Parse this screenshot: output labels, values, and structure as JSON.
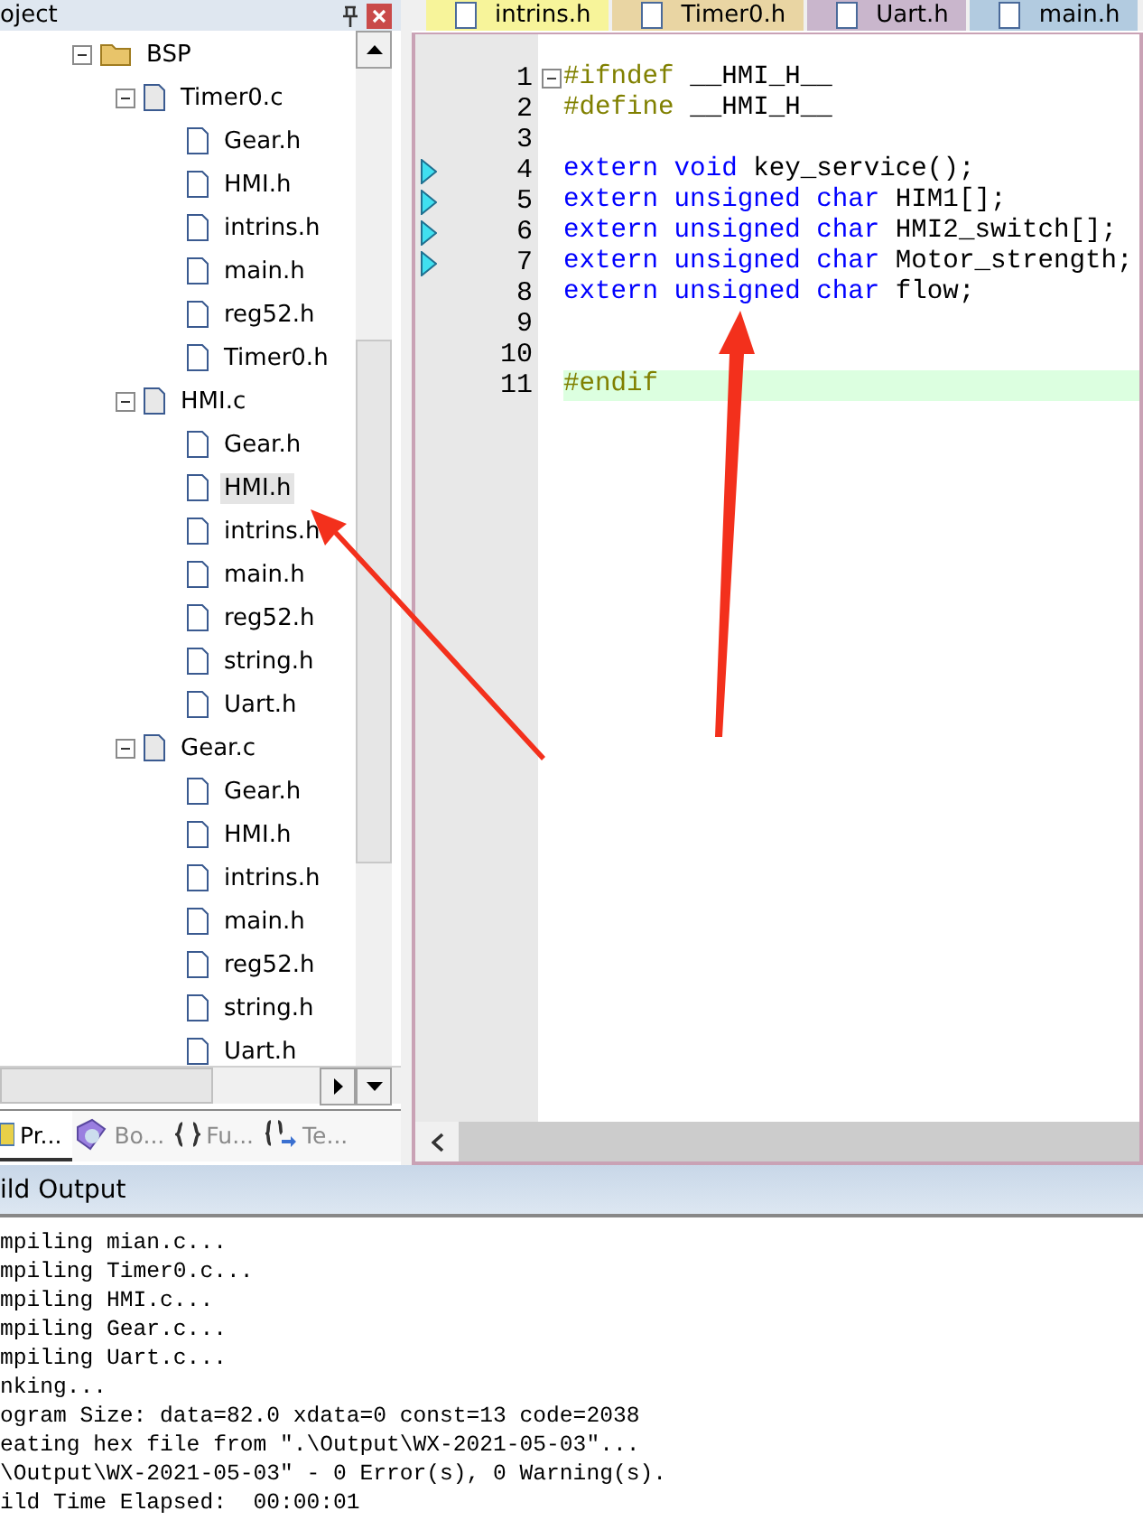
{
  "project_panel": {
    "title": "oject",
    "tree": [
      {
        "label": "BSP",
        "expanded": true,
        "selected": false,
        "children": [
          {
            "label": "Timer0.c",
            "expanded": true,
            "selected": false,
            "children": [
              {
                "label": "Gear.h",
                "selected": false
              },
              {
                "label": "HMI.h",
                "selected": false
              },
              {
                "label": "intrins.h",
                "selected": false
              },
              {
                "label": "main.h",
                "selected": false
              },
              {
                "label": "reg52.h",
                "selected": false
              },
              {
                "label": "Timer0.h",
                "selected": false
              }
            ]
          },
          {
            "label": "HMI.c",
            "expanded": true,
            "selected": false,
            "children": [
              {
                "label": "Gear.h",
                "selected": false
              },
              {
                "label": "HMI.h",
                "selected": true
              },
              {
                "label": "intrins.h",
                "selected": false
              },
              {
                "label": "main.h",
                "selected": false
              },
              {
                "label": "reg52.h",
                "selected": false
              },
              {
                "label": "string.h",
                "selected": false
              },
              {
                "label": "Uart.h",
                "selected": false
              }
            ]
          },
          {
            "label": "Gear.c",
            "expanded": true,
            "selected": false,
            "children": [
              {
                "label": "Gear.h",
                "selected": false
              },
              {
                "label": "HMI.h",
                "selected": false
              },
              {
                "label": "intrins.h",
                "selected": false
              },
              {
                "label": "main.h",
                "selected": false
              },
              {
                "label": "reg52.h",
                "selected": false
              },
              {
                "label": "string.h",
                "selected": false
              },
              {
                "label": "Uart.h",
                "selected": false
              }
            ]
          }
        ]
      }
    ],
    "tabs": [
      {
        "label": "Pr...",
        "kind": "project",
        "selected": true
      },
      {
        "label": "Bo...",
        "kind": "books",
        "selected": false
      },
      {
        "label": "Fu...",
        "kind": "functions",
        "selected": false
      },
      {
        "label": "Te...",
        "kind": "templates",
        "selected": false
      }
    ]
  },
  "editor": {
    "tabs": [
      {
        "label": "intrins.h",
        "color": "#f7f49a"
      },
      {
        "label": "Timer0.h",
        "color": "#e9d5a3"
      },
      {
        "label": "Uart.h",
        "color": "#c9b6cc"
      },
      {
        "label": "main.h",
        "color": "#b2cbe0"
      }
    ],
    "lines": [
      {
        "number": "1",
        "marker": false,
        "current": false,
        "tokens": [
          {
            "kind": "pre",
            "text": "#ifndef"
          },
          {
            "kind": "plain",
            "text": " __HMI_H__"
          }
        ]
      },
      {
        "number": "2",
        "marker": false,
        "current": false,
        "tokens": [
          {
            "kind": "pre",
            "text": "#define"
          },
          {
            "kind": "plain",
            "text": " __HMI_H__"
          }
        ]
      },
      {
        "number": "3",
        "marker": false,
        "current": false
      },
      {
        "number": "4",
        "marker": true,
        "current": false,
        "tokens": [
          {
            "kind": "keyword",
            "text": "extern void"
          },
          {
            "kind": "plain",
            "text": " key_service();"
          }
        ]
      },
      {
        "number": "5",
        "marker": true,
        "current": false,
        "tokens": [
          {
            "kind": "keyword",
            "text": "extern unsigned char"
          },
          {
            "kind": "plain",
            "text": " HIM1[];"
          }
        ]
      },
      {
        "number": "6",
        "marker": true,
        "current": false,
        "tokens": [
          {
            "kind": "keyword",
            "text": "extern unsigned char"
          },
          {
            "kind": "plain",
            "text": " HMI2_switch[];"
          }
        ]
      },
      {
        "number": "7",
        "marker": true,
        "current": false,
        "tokens": [
          {
            "kind": "keyword",
            "text": "extern unsigned char"
          },
          {
            "kind": "plain",
            "text": " Motor_strength;"
          }
        ]
      },
      {
        "number": "8",
        "marker": false,
        "current": false,
        "tokens": [
          {
            "kind": "keyword",
            "text": "extern unsigned char"
          },
          {
            "kind": "plain",
            "text": " flow;"
          }
        ]
      },
      {
        "number": "9",
        "marker": false,
        "current": false
      },
      {
        "number": "10",
        "marker": false,
        "current": false
      },
      {
        "number": "11",
        "marker": false,
        "current": true,
        "tokens": [
          {
            "kind": "pre",
            "text": "#endif"
          }
        ]
      }
    ]
  },
  "build_output": {
    "title": "ild Output",
    "lines": [
      "mpiling mian.c...",
      "mpiling Timer0.c...",
      "mpiling HMI.c...",
      "mpiling Gear.c...",
      "mpiling Uart.c...",
      "nking...",
      "ogram Size: data=82.0 xdata=0 const=13 code=2038",
      "eating hex file from \".\\Output\\WX-2021-05-03\"...",
      "\\Output\\WX-2021-05-03\" - 0 Error(s), 0 Warning(s).",
      "ild Time Elapsed:  00:00:01"
    ]
  }
}
